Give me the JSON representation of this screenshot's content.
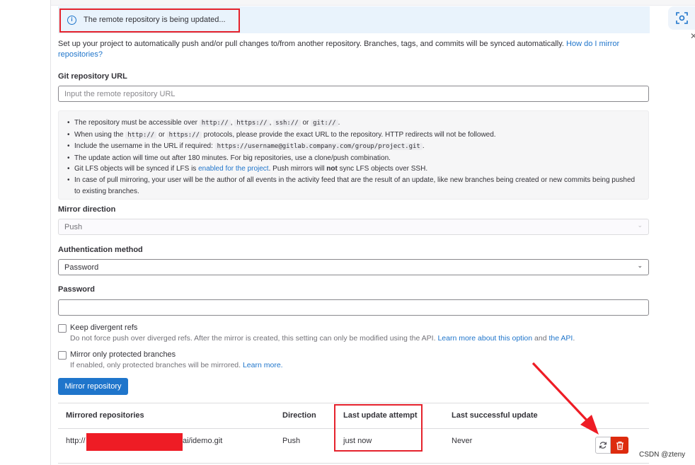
{
  "alert": {
    "text": "The remote repository is being updated..."
  },
  "intro": {
    "text": "Set up your project to automatically push and/or pull changes to/from another repository. Branches, tags, and commits will be synced automatically. ",
    "link": "How do I mirror repositories?"
  },
  "git_url": {
    "label": "Git repository URL",
    "placeholder": "Input the remote repository URL"
  },
  "help": {
    "b1": {
      "pre": "The repository must be accessible over ",
      "c1": "http://",
      "s1": ", ",
      "c2": "https://",
      "s2": ", ",
      "c3": "ssh://",
      "s3": " or ",
      "c4": "git://",
      "post": "."
    },
    "b2": {
      "pre": "When using the ",
      "c1": "http://",
      "s1": " or ",
      "c2": "https://",
      "post": " protocols, please provide the exact URL to the repository. HTTP redirects will not be followed."
    },
    "b3": {
      "pre": "Include the username in the URL if required: ",
      "code": "https://username@gitlab.company.com/group/project.git",
      "post": "."
    },
    "b4": {
      "text": "The update action will time out after 180 minutes. For big repositories, use a clone/push combination."
    },
    "b5": {
      "pre": "Git LFS objects will be synced if LFS is ",
      "link": "enabled for the project",
      "mid": ". Push mirrors will ",
      "bold": "not",
      "post": " sync LFS objects over SSH."
    },
    "b6": {
      "text": "In case of pull mirroring, your user will be the author of all events in the activity feed that are the result of an update, like new branches being created or new commits being pushed to existing branches."
    }
  },
  "mirror_direction": {
    "label": "Mirror direction",
    "value": "Push"
  },
  "auth_method": {
    "label": "Authentication method",
    "value": "Password"
  },
  "password": {
    "label": "Password",
    "value": ""
  },
  "keep_divergent": {
    "label": "Keep divergent refs",
    "help_pre": "Do not force push over diverged refs. After the mirror is created, this setting can only be modified using the API. ",
    "link1": "Learn more about this option",
    "mid": " and ",
    "link2": "the API",
    "post": "."
  },
  "protected_only": {
    "label": "Mirror only protected branches",
    "help_pre": "If enabled, only protected branches will be mirrored. ",
    "link": "Learn more."
  },
  "submit": {
    "label": "Mirror repository"
  },
  "table": {
    "headers": [
      "Mirrored repositories",
      "Direction",
      "Last update attempt",
      "Last successful update"
    ],
    "rows": [
      {
        "url_prefix": "http://",
        "url_suffix": "ai/idemo.git",
        "direction": "Push",
        "last_attempt": "just now",
        "last_success": "Never"
      }
    ]
  },
  "watermark": "CSDN @zteny",
  "colors": {
    "primary": "#1f75cb",
    "danger": "#dd2b0e",
    "annotation_red": "#e5222c",
    "alert_bg": "#e9f3fc"
  },
  "icons": [
    "info-icon",
    "screenshot-icon",
    "close-icon",
    "chevron-down-icon",
    "retry-icon",
    "trash-icon"
  ]
}
